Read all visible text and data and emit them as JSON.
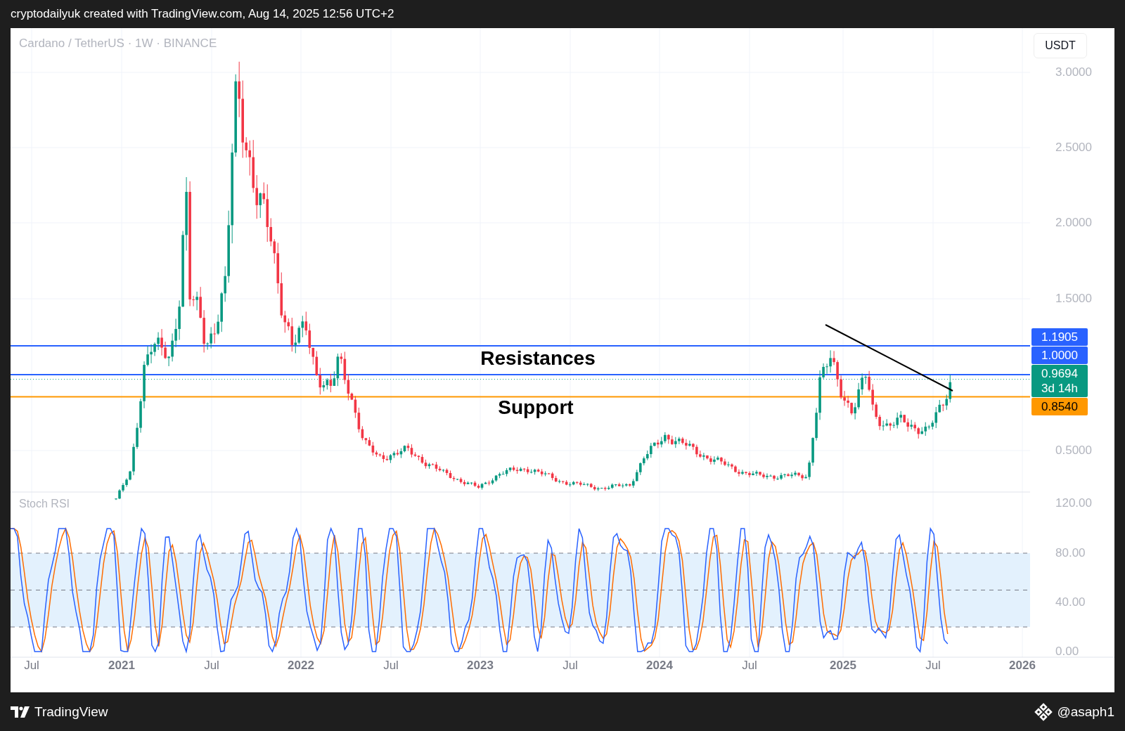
{
  "header": {
    "text": "cryptodailyuk created with TradingView.com, Aug 14, 2025 12:56 UTC+2"
  },
  "chart": {
    "legend": "Cardano / TetherUS · 1W · BINANCE",
    "currency_button": "USDT",
    "price_axis": [
      "3.0000",
      "2.5000",
      "2.0000",
      "1.5000",
      "0.5000"
    ],
    "price_labels": [
      {
        "text": "1.1905",
        "color": "#2962ff"
      },
      {
        "text": "1.0000",
        "color": "#2962ff"
      },
      {
        "text": "0.9694",
        "countdown": "3d 14h",
        "color": "#089981"
      },
      {
        "text": "0.8540",
        "color": "#ff9800"
      }
    ],
    "annotations": [
      "Resistances",
      "Support"
    ],
    "indicator": {
      "name": "Stoch RSI",
      "axis": [
        "120.00",
        "80.00",
        "40.00",
        "0.00"
      ]
    },
    "time_axis": [
      {
        "text": "Jul",
        "kind": "month"
      },
      {
        "text": "2021",
        "kind": "year"
      },
      {
        "text": "Jul",
        "kind": "month"
      },
      {
        "text": "2022",
        "kind": "year"
      },
      {
        "text": "Jul",
        "kind": "month"
      },
      {
        "text": "2023",
        "kind": "year"
      },
      {
        "text": "Jul",
        "kind": "month"
      },
      {
        "text": "2024",
        "kind": "year"
      },
      {
        "text": "Jul",
        "kind": "month"
      },
      {
        "text": "2025",
        "kind": "year"
      },
      {
        "text": "Jul",
        "kind": "month"
      },
      {
        "text": "2026",
        "kind": "year"
      }
    ]
  },
  "footer": {
    "brand": "TradingView",
    "author": "@asaph1"
  }
}
